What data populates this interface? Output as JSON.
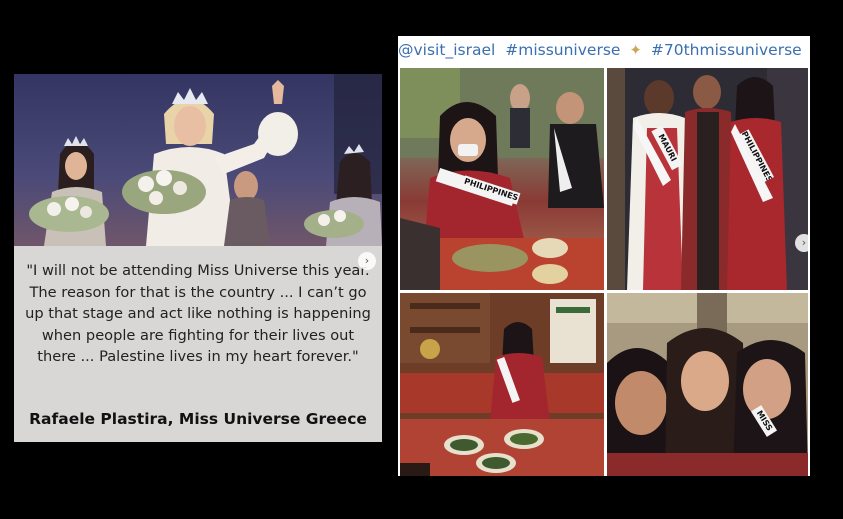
{
  "left_card": {
    "quote": "\"I will not be attending Miss Universe this year. The reason for that is the country ... I can’t go up that stage and act like nothing is happening when people are fighting for their lives out there ... Palestine lives in my heart forever.\"",
    "author": "Rafaele Plastira, Miss Universe Greece",
    "next_arrow": "›"
  },
  "right_card": {
    "hashtags": [
      "@visit_israel",
      "#missuniverse",
      "#70thmissuniverse"
    ],
    "sparkle": "✦",
    "sashes": {
      "philippines_1": "PHILIPPINES",
      "mauritius": "MAURI",
      "philippines_2": "PHILIPPINES",
      "miss_4": "MISS"
    },
    "next_arrow": "›"
  },
  "colors": {
    "background": "#000000",
    "hashtag": "#3a6fb0",
    "sparkle": "#c9a85a",
    "quote_panel": "#d9d6d6"
  }
}
